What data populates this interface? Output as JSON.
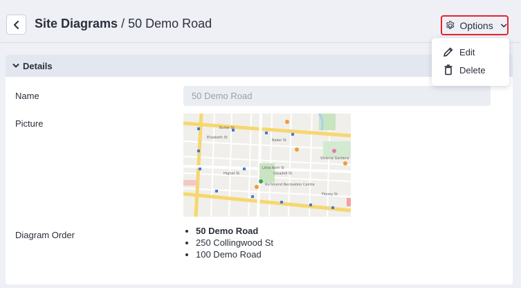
{
  "header": {
    "breadcrumb_parent": "Site Diagrams",
    "separator": " / ",
    "current": "50 Demo Road",
    "options_label": "Options"
  },
  "details": {
    "section_title": "Details",
    "name_label": "Name",
    "name_value": "50 Demo Road",
    "picture_label": "Picture",
    "order_label": "Diagram Order",
    "order_items": [
      "50 Demo Road",
      "250 Collingwood St",
      "100 Demo Road"
    ]
  },
  "map": {
    "labels": [
      "Butler St",
      "Elizabeth St",
      "Baker St",
      "Victoria Gardens",
      "Highet St",
      "Richmond Recreation Centre",
      "Little Kent St",
      "Gleadell St",
      "Fitzroy St"
    ]
  },
  "menu": {
    "items": [
      {
        "label": "Edit",
        "icon": "pencil-icon"
      },
      {
        "label": "Delete",
        "icon": "trash-icon"
      }
    ]
  },
  "colors": {
    "accent_red": "#e5232d",
    "page_bg": "#eef0f6",
    "section_header_bg": "#e3e7f0"
  }
}
